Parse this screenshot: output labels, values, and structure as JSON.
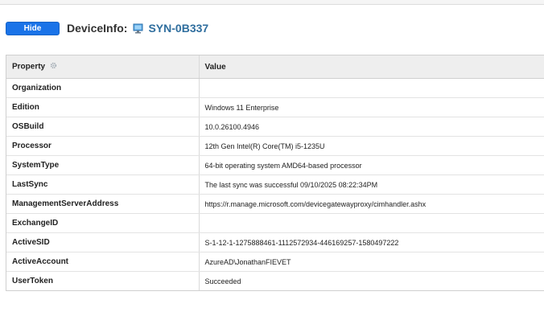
{
  "header": {
    "hide_label": "Hide",
    "title_label": "DeviceInfo:",
    "device_name": "SYN-0B337",
    "device_icon": "computer-icon"
  },
  "table": {
    "columns": [
      "Property",
      "Value"
    ],
    "sort_icon": "gear-icon",
    "rows": [
      {
        "property": "Organization",
        "value": ""
      },
      {
        "property": "Edition",
        "value": "Windows 11 Enterprise"
      },
      {
        "property": "OSBuild",
        "value": "10.0.26100.4946"
      },
      {
        "property": "Processor",
        "value": "12th Gen Intel(R) Core(TM) i5-1235U"
      },
      {
        "property": "SystemType",
        "value": "64-bit operating system AMD64-based processor"
      },
      {
        "property": "LastSync",
        "value": "The last sync was successful 09/10/2025 08:22:34PM"
      },
      {
        "property": "ManagementServerAddress",
        "value": "https://r.manage.microsoft.com/devicegatewayproxy/cimhandler.ashx"
      },
      {
        "property": "ExchangeID",
        "value": ""
      },
      {
        "property": "ActiveSID",
        "value": "S-1-12-1-1275888461-1112572934-446169257-1580497222"
      },
      {
        "property": "ActiveAccount",
        "value": "AzureAD\\JonathanFIEVET"
      },
      {
        "property": "UserToken",
        "value": "Succeeded"
      }
    ]
  },
  "colors": {
    "button": "#1a73e8",
    "link": "#2f6e9e",
    "header_bg": "#eeeeee"
  }
}
